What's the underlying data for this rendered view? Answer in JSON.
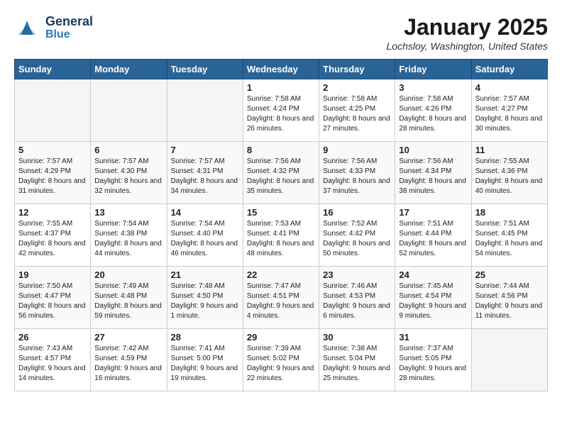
{
  "header": {
    "logo_line1": "General",
    "logo_line2": "Blue",
    "month_title": "January 2025",
    "location": "Lochsloy, Washington, United States"
  },
  "weekdays": [
    "Sunday",
    "Monday",
    "Tuesday",
    "Wednesday",
    "Thursday",
    "Friday",
    "Saturday"
  ],
  "weeks": [
    [
      {
        "day": "",
        "text": ""
      },
      {
        "day": "",
        "text": ""
      },
      {
        "day": "",
        "text": ""
      },
      {
        "day": "1",
        "text": "Sunrise: 7:58 AM\nSunset: 4:24 PM\nDaylight: 8 hours and 26 minutes."
      },
      {
        "day": "2",
        "text": "Sunrise: 7:58 AM\nSunset: 4:25 PM\nDaylight: 8 hours and 27 minutes."
      },
      {
        "day": "3",
        "text": "Sunrise: 7:58 AM\nSunset: 4:26 PM\nDaylight: 8 hours and 28 minutes."
      },
      {
        "day": "4",
        "text": "Sunrise: 7:57 AM\nSunset: 4:27 PM\nDaylight: 8 hours and 30 minutes."
      }
    ],
    [
      {
        "day": "5",
        "text": "Sunrise: 7:57 AM\nSunset: 4:29 PM\nDaylight: 8 hours and 31 minutes."
      },
      {
        "day": "6",
        "text": "Sunrise: 7:57 AM\nSunset: 4:30 PM\nDaylight: 8 hours and 32 minutes."
      },
      {
        "day": "7",
        "text": "Sunrise: 7:57 AM\nSunset: 4:31 PM\nDaylight: 8 hours and 34 minutes."
      },
      {
        "day": "8",
        "text": "Sunrise: 7:56 AM\nSunset: 4:32 PM\nDaylight: 8 hours and 35 minutes."
      },
      {
        "day": "9",
        "text": "Sunrise: 7:56 AM\nSunset: 4:33 PM\nDaylight: 8 hours and 37 minutes."
      },
      {
        "day": "10",
        "text": "Sunrise: 7:56 AM\nSunset: 4:34 PM\nDaylight: 8 hours and 38 minutes."
      },
      {
        "day": "11",
        "text": "Sunrise: 7:55 AM\nSunset: 4:36 PM\nDaylight: 8 hours and 40 minutes."
      }
    ],
    [
      {
        "day": "12",
        "text": "Sunrise: 7:55 AM\nSunset: 4:37 PM\nDaylight: 8 hours and 42 minutes."
      },
      {
        "day": "13",
        "text": "Sunrise: 7:54 AM\nSunset: 4:38 PM\nDaylight: 8 hours and 44 minutes."
      },
      {
        "day": "14",
        "text": "Sunrise: 7:54 AM\nSunset: 4:40 PM\nDaylight: 8 hours and 46 minutes."
      },
      {
        "day": "15",
        "text": "Sunrise: 7:53 AM\nSunset: 4:41 PM\nDaylight: 8 hours and 48 minutes."
      },
      {
        "day": "16",
        "text": "Sunrise: 7:52 AM\nSunset: 4:42 PM\nDaylight: 8 hours and 50 minutes."
      },
      {
        "day": "17",
        "text": "Sunrise: 7:51 AM\nSunset: 4:44 PM\nDaylight: 8 hours and 52 minutes."
      },
      {
        "day": "18",
        "text": "Sunrise: 7:51 AM\nSunset: 4:45 PM\nDaylight: 8 hours and 54 minutes."
      }
    ],
    [
      {
        "day": "19",
        "text": "Sunrise: 7:50 AM\nSunset: 4:47 PM\nDaylight: 8 hours and 56 minutes."
      },
      {
        "day": "20",
        "text": "Sunrise: 7:49 AM\nSunset: 4:48 PM\nDaylight: 8 hours and 59 minutes."
      },
      {
        "day": "21",
        "text": "Sunrise: 7:48 AM\nSunset: 4:50 PM\nDaylight: 9 hours and 1 minute."
      },
      {
        "day": "22",
        "text": "Sunrise: 7:47 AM\nSunset: 4:51 PM\nDaylight: 9 hours and 4 minutes."
      },
      {
        "day": "23",
        "text": "Sunrise: 7:46 AM\nSunset: 4:53 PM\nDaylight: 9 hours and 6 minutes."
      },
      {
        "day": "24",
        "text": "Sunrise: 7:45 AM\nSunset: 4:54 PM\nDaylight: 9 hours and 9 minutes."
      },
      {
        "day": "25",
        "text": "Sunrise: 7:44 AM\nSunset: 4:56 PM\nDaylight: 9 hours and 11 minutes."
      }
    ],
    [
      {
        "day": "26",
        "text": "Sunrise: 7:43 AM\nSunset: 4:57 PM\nDaylight: 9 hours and 14 minutes."
      },
      {
        "day": "27",
        "text": "Sunrise: 7:42 AM\nSunset: 4:59 PM\nDaylight: 9 hours and 16 minutes."
      },
      {
        "day": "28",
        "text": "Sunrise: 7:41 AM\nSunset: 5:00 PM\nDaylight: 9 hours and 19 minutes."
      },
      {
        "day": "29",
        "text": "Sunrise: 7:39 AM\nSunset: 5:02 PM\nDaylight: 9 hours and 22 minutes."
      },
      {
        "day": "30",
        "text": "Sunrise: 7:38 AM\nSunset: 5:04 PM\nDaylight: 9 hours and 25 minutes."
      },
      {
        "day": "31",
        "text": "Sunrise: 7:37 AM\nSunset: 5:05 PM\nDaylight: 9 hours and 28 minutes."
      },
      {
        "day": "",
        "text": ""
      }
    ]
  ]
}
